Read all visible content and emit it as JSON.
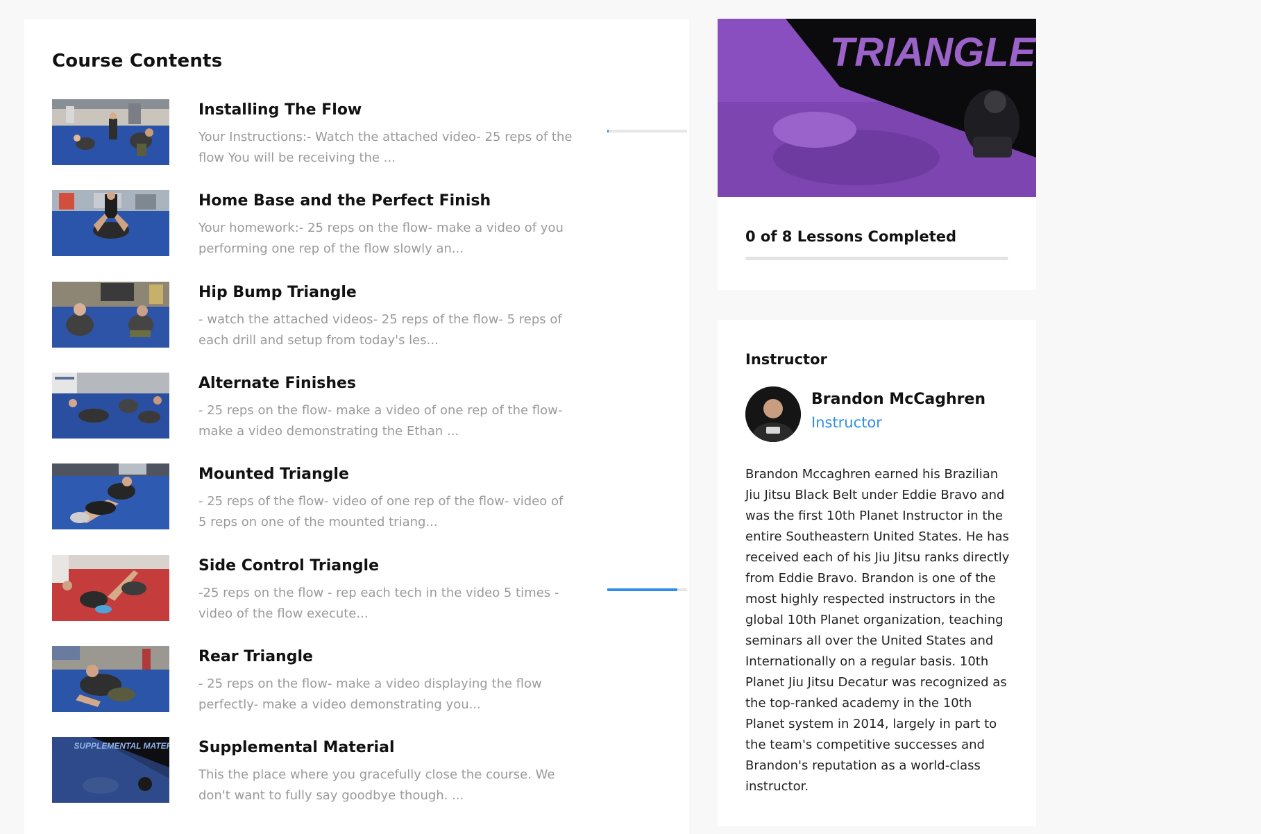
{
  "course_contents": {
    "heading": "Course Contents",
    "lessons": [
      {
        "title": "Installing The Flow",
        "description": "Your Instructions:- Watch the attached video- 25 reps of the flow You will be receiving the ...",
        "thumbnail": "mat-training-photo",
        "progress": 0.02
      },
      {
        "title": "Home Base and the Perfect Finish",
        "description": "Your homework:- 25 reps on the flow- make a video of you performing one rep of the flow slowly an...",
        "thumbnail": "mat-training-photo",
        "progress": null
      },
      {
        "title": "Hip Bump Triangle",
        "description": "- watch the attached videos- 25 reps of the flow- 5 reps of each drill and setup from today's les...",
        "thumbnail": "mat-training-photo",
        "progress": null
      },
      {
        "title": "Alternate Finishes",
        "description": "- 25 reps on the flow- make a video of one rep of the flow- make a video demonstrating the Ethan ...",
        "thumbnail": "mat-training-photo",
        "progress": null
      },
      {
        "title": "Mounted Triangle",
        "description": "- 25 reps of the flow- video of one rep of the flow- video of 5 reps on one of the mounted triang...",
        "thumbnail": "mat-training-photo",
        "progress": null
      },
      {
        "title": "Side Control Triangle",
        "description": "-25 reps on the flow - rep each tech in the video 5 times - video of the flow execute...",
        "thumbnail": "red-mat-training-photo",
        "progress": 0.88
      },
      {
        "title": "Rear Triangle",
        "description": "- 25 reps on the flow- make a video displaying the flow perfectly- make a video demonstrating you...",
        "thumbnail": "mat-training-photo",
        "progress": null
      },
      {
        "title": "Supplemental Material",
        "description": "This the place where you gracefully close the course. We don't want to fully say goodbye though. ...",
        "thumbnail": "supplemental-material-banner",
        "thumbnail_text": "SUPPLEMENTAL MATERIAL",
        "progress": null
      }
    ]
  },
  "course_banner": {
    "title": "TRIANGLE",
    "accent": "#8a4fbf"
  },
  "progress_summary": {
    "label": "0 of 8 Lessons Completed",
    "completed": 0,
    "total": 8
  },
  "instructor": {
    "heading": "Instructor",
    "name": "Brandon McCaghren",
    "role": "Instructor",
    "bio": "Brandon Mccaghren earned his Brazilian Jiu Jitsu Black Belt under Eddie Bravo and was the first 10th Planet Instructor in the entire Southeastern United States. He has received each of his Jiu Jitsu ranks directly from Eddie Bravo. Brandon is one of the most highly respected instructors in the global 10th Planet organization, teaching seminars all over the United States and Internationally on a regular basis. 10th Planet Jiu Jitsu Decatur was recognized as the top-ranked academy in the 10th Planet system in 2014, largely in part to the team's competitive successes and Brandon's reputation as a world-class instructor."
  },
  "colors": {
    "accent_blue": "#2f8ee8",
    "muted_text": "#9a9a9a",
    "page_bg": "#f8f8f8"
  }
}
